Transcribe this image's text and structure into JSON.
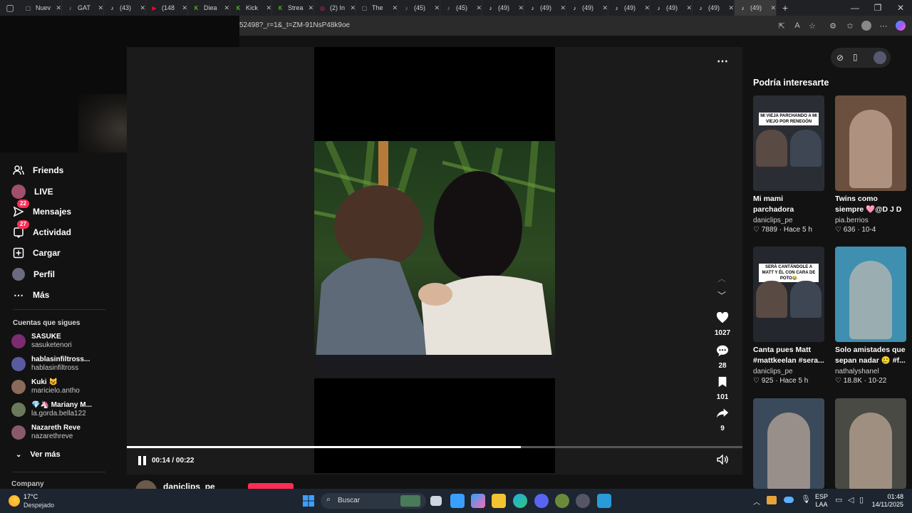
{
  "browser": {
    "tabs": [
      {
        "label": "Nuev",
        "icon": "doc-icon",
        "color": "#9aa0a6"
      },
      {
        "label": "GAT",
        "icon": "tiktok-icon",
        "color": "#9aa0a6"
      },
      {
        "label": "(43)",
        "icon": "tiktok-icon",
        "color": "#ffffff"
      },
      {
        "label": "(148",
        "icon": "youtube-icon",
        "color": "#ff0033"
      },
      {
        "label": "Diea",
        "icon": "kick-icon",
        "color": "#53fc18"
      },
      {
        "label": "Kick",
        "icon": "kick-icon",
        "color": "#53fc18"
      },
      {
        "label": "Strea",
        "icon": "kick-icon",
        "color": "#53fc18"
      },
      {
        "label": "(2) In",
        "icon": "instagram-icon",
        "color": "#e1306c"
      },
      {
        "label": "The",
        "icon": "web-icon",
        "color": "#9aa0a6"
      },
      {
        "label": "(45)",
        "icon": "tiktok-icon",
        "color": "#9aa0a6"
      },
      {
        "label": "(45)",
        "icon": "tiktok-icon",
        "color": "#9aa0a6"
      },
      {
        "label": "(49)",
        "icon": "tiktok-icon",
        "color": "#ffffff"
      },
      {
        "label": "(49)",
        "icon": "tiktok-icon",
        "color": "#ffffff"
      },
      {
        "label": "(49)",
        "icon": "tiktok-icon",
        "color": "#ffffff"
      },
      {
        "label": "(49)",
        "icon": "tiktok-icon",
        "color": "#ffffff"
      },
      {
        "label": "(49)",
        "icon": "tiktok-icon",
        "color": "#ffffff"
      },
      {
        "label": "(49)",
        "icon": "tiktok-icon",
        "color": "#ffffff"
      },
      {
        "label": "(49)",
        "icon": "tiktok-icon",
        "color": "#ffffff"
      }
    ],
    "url": "52498?_r=1&_t=ZM-91NsP48k9oe"
  },
  "sidebar": {
    "nav": [
      {
        "label": "Friends",
        "icon": "friends-icon",
        "badge": ""
      },
      {
        "label": "LIVE",
        "icon": "live-icon",
        "badge": ""
      },
      {
        "label": "Mensajes",
        "icon": "messages-icon",
        "badge": "22"
      },
      {
        "label": "Actividad",
        "icon": "activity-icon",
        "badge": "27"
      },
      {
        "label": "Cargar",
        "icon": "upload-icon",
        "badge": ""
      },
      {
        "label": "Perfil",
        "icon": "profile-icon",
        "badge": ""
      },
      {
        "label": "Más",
        "icon": "more-icon",
        "badge": ""
      }
    ],
    "following_title": "Cuentas que sigues",
    "following": [
      {
        "name": "SASUKE",
        "user": "sasuketenori",
        "avatar_color": "#7b2d6f"
      },
      {
        "name": "hablasinfiltross...",
        "user": "hablasinfiltross",
        "avatar_color": "#5a5aa0"
      },
      {
        "name": "Kuki 😺",
        "user": "maricielo.antho",
        "avatar_color": "#8a6a5a"
      },
      {
        "name": "💎🦄 Mariany M...",
        "user": "la.gorda.bella122",
        "avatar_color": "#6a7a5a"
      },
      {
        "name": "Nazareth Reve",
        "user": "nazarethreve",
        "avatar_color": "#8a5a6a"
      }
    ],
    "see_more": "Ver más",
    "company": "Company"
  },
  "player": {
    "actions": [
      {
        "name": "like",
        "icon": "heart-icon",
        "count": "1027"
      },
      {
        "name": "comment",
        "icon": "comment-icon",
        "count": "28"
      },
      {
        "name": "save",
        "icon": "bookmark-icon",
        "count": "101"
      },
      {
        "name": "share",
        "icon": "share-icon",
        "count": "9"
      }
    ],
    "time": "00:14 / 00:22",
    "progress": 0.64,
    "author": "daniclips_pe"
  },
  "recommendations": {
    "title": "Podría interesarte",
    "items": [
      {
        "title": "Mi mami parchadora #mattkeelan #sera...",
        "author": "daniclips_pe",
        "meta": "♡ 7889 · Hace 5 h",
        "caption": "MI VIEJA PARCHANDO A MI VIEJO POR RENEGÓN",
        "thumb": "#2a2e34"
      },
      {
        "title": "Twins como siempre 🩷@D J D R E I S A...",
        "author": "pia.berrios",
        "meta": "♡ 636 · 10-4",
        "caption": "",
        "thumb": "#6b4f3f"
      },
      {
        "title": "Canta pues Matt #mattkeelan #sera...",
        "author": "daniclips_pe",
        "meta": "♡ 925 · Hace 5 h",
        "caption": "SERÁ CANTÁNDOLE A MATT Y ÉL CON CARA DE POTO😂",
        "thumb": "#24282e"
      },
      {
        "title": "Solo amistades que sepan nadar 🥲 #f...",
        "author": "nathalyshanel",
        "meta": "♡ 18.8K · 10-22",
        "caption": "",
        "thumb": "#3f8fb0"
      },
      {
        "title": "",
        "author": "",
        "meta": "",
        "caption": "",
        "thumb": "#3a4a5a"
      },
      {
        "title": "",
        "author": "",
        "meta": "",
        "caption": "",
        "thumb": "#4a4a44"
      }
    ]
  },
  "taskbar": {
    "weather_temp": "17°C",
    "weather_desc": "Despejado",
    "search": "Buscar",
    "lang": "ESP",
    "lang2": "LAA",
    "time": "01:48",
    "date": "14/11/2025"
  }
}
